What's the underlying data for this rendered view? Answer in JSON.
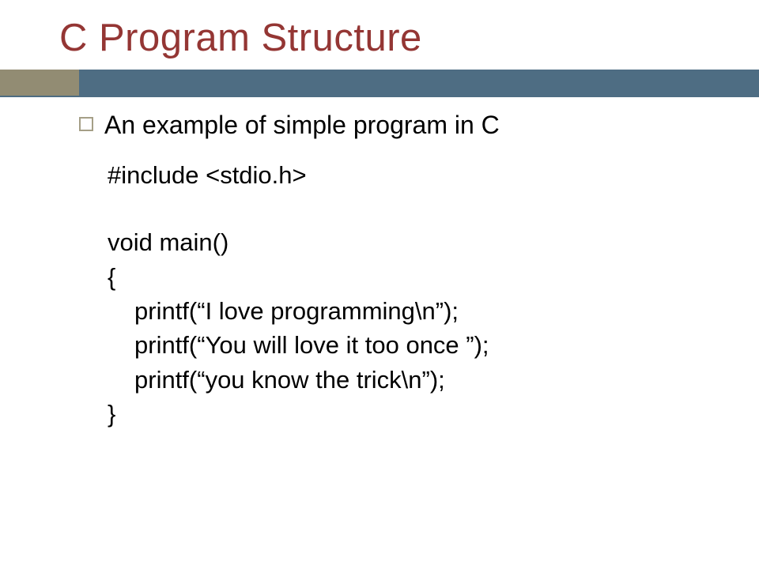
{
  "title": "C Program Structure",
  "bullet": "An example of simple program in C",
  "code": {
    "l1": "#include <stdio.h>",
    "l2": "void main()",
    "l3": "{",
    "l4": "printf(“I love programming\\n”);",
    "l5": "printf(“You will love it too once ”);",
    "l6": "printf(“you know the trick\\n”);",
    "l7": "}"
  }
}
